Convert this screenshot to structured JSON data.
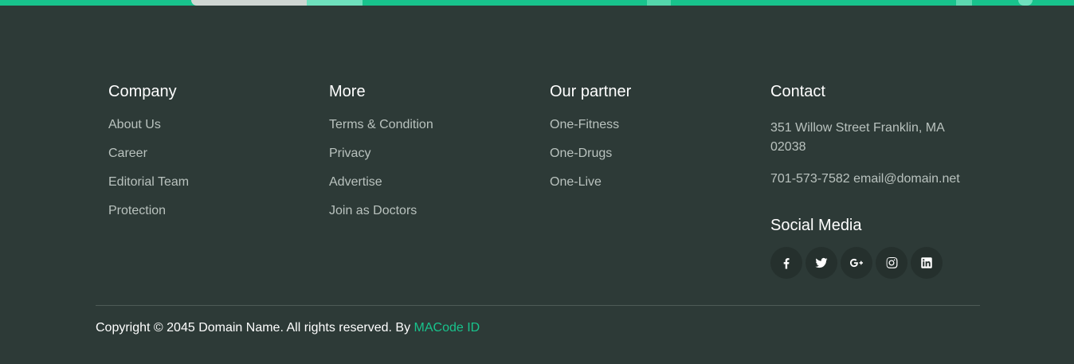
{
  "colors": {
    "background": "#2d3a37",
    "accent": "#18c38c",
    "link": "#b9c2be"
  },
  "company": {
    "title": "Company",
    "links": [
      "About Us",
      "Career",
      "Editorial Team",
      "Protection"
    ]
  },
  "more": {
    "title": "More",
    "links": [
      "Terms & Condition",
      "Privacy",
      "Advertise",
      "Join as Doctors"
    ]
  },
  "partner": {
    "title": "Our partner",
    "links": [
      "One-Fitness",
      "One-Drugs",
      "One-Live"
    ]
  },
  "contact": {
    "title": "Contact",
    "address": "351 Willow Street Franklin, MA 02038",
    "phone_email": "701-573-7582 email@domain.net"
  },
  "social": {
    "title": "Social Media",
    "icons": [
      "facebook-icon",
      "twitter-icon",
      "google-plus-icon",
      "instagram-icon",
      "linkedin-icon"
    ]
  },
  "footer": {
    "copyright": "Copyright © 2045 Domain Name. All rights reserved. By ",
    "author": "MACode ID"
  }
}
